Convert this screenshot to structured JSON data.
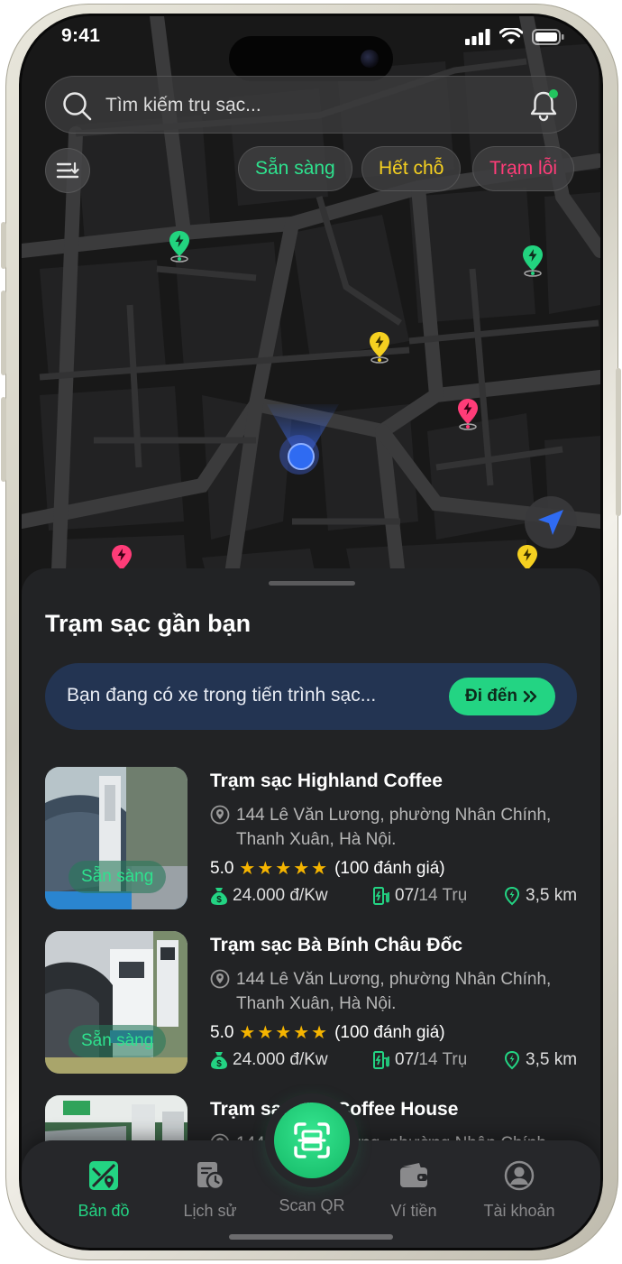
{
  "status": {
    "time": "9:41"
  },
  "search": {
    "placeholder": "Tìm kiếm trụ sạc..."
  },
  "filters": [
    {
      "label": "Sẵn sàng",
      "color": "#2ee28e"
    },
    {
      "label": "Hết chỗ",
      "color": "#f5d020"
    },
    {
      "label": "Trạm lỗi",
      "color": "#ff3c78"
    }
  ],
  "map_pins": [
    {
      "status": "available",
      "color": "#22d37f"
    },
    {
      "status": "available",
      "color": "#22d37f"
    },
    {
      "status": "full",
      "color": "#f5d020"
    },
    {
      "status": "error",
      "color": "#ff3c78"
    },
    {
      "status": "error",
      "color": "#ff3c78"
    },
    {
      "status": "full",
      "color": "#f5d020"
    }
  ],
  "sheet": {
    "title": "Trạm sạc gần bạn",
    "banner": {
      "text": "Bạn đang có xe trong tiến trình sạc...",
      "button": "Đi đến"
    }
  },
  "stations": [
    {
      "name": "Trạm sạc Highland Coffee",
      "address": "144 Lê Văn Lương, phường Nhân Chính, Thanh Xuân, Hà Nội.",
      "rating": "5.0",
      "stars": "★★★★★",
      "reviews": "(100 đánh giá)",
      "price": "24.000 đ/Kw",
      "ports_used": "07/",
      "ports_total": "14 Trụ",
      "distance": "3,5 km",
      "badge": "Sẵn sàng"
    },
    {
      "name": "Trạm sạc Bà Bính Châu Đốc",
      "address": "144 Lê Văn Lương, phường Nhân Chính, Thanh Xuân, Hà Nội.",
      "rating": "5.0",
      "stars": "★★★★★",
      "reviews": "(100 đánh giá)",
      "price": "24.000 đ/Kw",
      "ports_used": "07/",
      "ports_total": "14 Trụ",
      "distance": "3,5 km",
      "badge": "Sẵn sàng"
    },
    {
      "name": "Trạm sạc The Coffee House",
      "address": "144 Lê Văn Lương, phường Nhân Chính,"
    }
  ],
  "tabs": [
    {
      "label": "Bản đồ",
      "icon": "map-icon",
      "active": true
    },
    {
      "label": "Lịch sử",
      "icon": "history-icon",
      "active": false
    },
    {
      "label": "Scan QR",
      "icon": "scan-icon",
      "active": false
    },
    {
      "label": "Ví tiền",
      "icon": "wallet-icon",
      "active": false
    },
    {
      "label": "Tài khoản",
      "icon": "account-icon",
      "active": false
    }
  ],
  "colors": {
    "accent": "#23d483",
    "available": "#2ee28e",
    "full": "#f5d020",
    "error": "#ff3c78"
  }
}
